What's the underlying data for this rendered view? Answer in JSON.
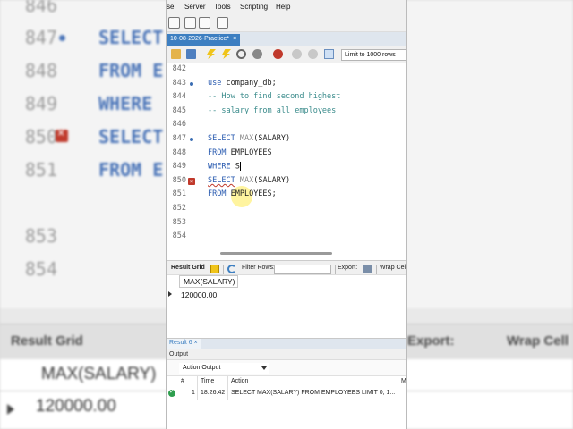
{
  "background": {
    "lines": [
      {
        "num": "846",
        "code": ""
      },
      {
        "num": "847",
        "code": "SELECT"
      },
      {
        "num": "848",
        "code": "FROM E"
      },
      {
        "num": "849",
        "code": "WHERE"
      },
      {
        "num": "850",
        "code": "SELECT"
      },
      {
        "num": "851",
        "code": "FROM E"
      },
      {
        "num": "853",
        "code": ""
      },
      {
        "num": "854",
        "code": ""
      }
    ],
    "result_grid_label": "Result Grid",
    "export_label": "Export:",
    "wrap_label": "Wrap Cell",
    "column_header": "MAX(SALARY)",
    "row_value": "120000.00"
  },
  "menubar": {
    "items": [
      "se",
      "Server",
      "Tools",
      "Scripting",
      "Help"
    ]
  },
  "tab": {
    "label": "10-08-2026-Practice*",
    "close": "×"
  },
  "toolbar": {
    "limit_label": "Limit to 1000 rows"
  },
  "editor": {
    "lines": [
      {
        "num": "842",
        "marker": ""
      },
      {
        "num": "843",
        "marker": "dot"
      },
      {
        "num": "844",
        "marker": ""
      },
      {
        "num": "845",
        "marker": ""
      },
      {
        "num": "846",
        "marker": ""
      },
      {
        "num": "847",
        "marker": "dot"
      },
      {
        "num": "848",
        "marker": ""
      },
      {
        "num": "849",
        "marker": ""
      },
      {
        "num": "850",
        "marker": "error"
      },
      {
        "num": "851",
        "marker": ""
      },
      {
        "num": "852",
        "marker": ""
      },
      {
        "num": "853",
        "marker": ""
      },
      {
        "num": "854",
        "marker": ""
      }
    ],
    "l843_kw": "use",
    "l843_rest": " company_db;",
    "l844": "-- How to find second highest",
    "l845": "-- salary from all employees",
    "l847_kw": "SELECT",
    "l847_fn": "MAX",
    "l847_rest": "(SALARY)",
    "l848_kw": "FROM",
    "l848_rest": " EMPLOYEES",
    "l849_kw": "WHERE",
    "l849_rest": " S",
    "l850_kw": "SELECT",
    "l850_fn": "MAX",
    "l850_rest": "(SALARY)",
    "l851_kw": "FROM",
    "l851_rest": " EMPLOYEES;"
  },
  "results": {
    "result_grid_label": "Result Grid",
    "filter_label": "Filter Rows:",
    "export_label": "Export:",
    "wrap_label": "Wrap Cell",
    "column_header": "MAX(SALARY)",
    "row_value": "120000.00",
    "result_tab": "Result 6",
    "result_tab_close": "×"
  },
  "output": {
    "header": "Output",
    "dropdown": "Action Output",
    "columns": [
      "#",
      "Time",
      "Action",
      "M"
    ],
    "row": {
      "num": "1",
      "time": "18:26:42",
      "action": "SELECT MAX(SALARY) FROM EMPLOYEES LIMIT 0, 1..."
    }
  }
}
